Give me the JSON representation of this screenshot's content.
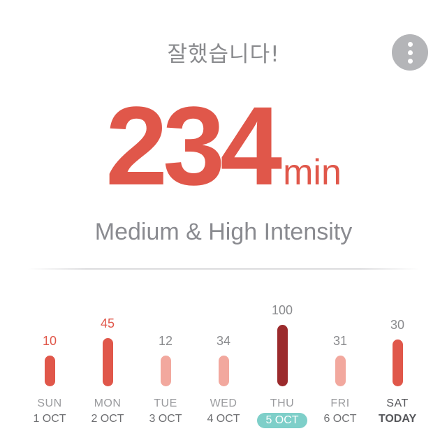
{
  "header": {
    "praise": "잘했습니다!",
    "more_icon": "more-vertical-icon"
  },
  "summary": {
    "value": "234",
    "unit": "min",
    "intensity": "Medium & High Intensity"
  },
  "colors": {
    "accent": "#e0574a",
    "bar_high": "#e0574a",
    "bar_low": "#f2a89e",
    "bar_selected": "#9b2a2c",
    "selected_badge": "#7ecfc9"
  },
  "chart_data": {
    "type": "bar",
    "categories": [
      "SUN 1 OCT",
      "MON 2 OCT",
      "TUE 3 OCT",
      "WED 4 OCT",
      "THU 5 OCT",
      "FRI 6 OCT",
      "SAT TODAY"
    ],
    "values": [
      10,
      45,
      12,
      34,
      100,
      31,
      30
    ],
    "ylim": [
      0,
      100
    ]
  },
  "week": [
    {
      "day": "SUN",
      "date": "1 OCT",
      "value": "10",
      "level": 0.5,
      "style": "high",
      "label_color": "red"
    },
    {
      "day": "MON",
      "date": "2 OCT",
      "value": "45",
      "level": 0.78,
      "style": "high",
      "label_color": "red"
    },
    {
      "day": "TUE",
      "date": "3 OCT",
      "value": "12",
      "level": 0.5,
      "style": "low",
      "label_color": "gray"
    },
    {
      "day": "WED",
      "date": "4 OCT",
      "value": "34",
      "level": 0.5,
      "style": "low",
      "label_color": "gray"
    },
    {
      "day": "THU",
      "date": "5 OCT",
      "value": "100",
      "level": 1.0,
      "style": "selected",
      "label_color": "gray",
      "selected": true
    },
    {
      "day": "FRI",
      "date": "6 OCT",
      "value": "31",
      "level": 0.5,
      "style": "low",
      "label_color": "gray"
    },
    {
      "day": "SAT",
      "date": "TODAY",
      "value": "30",
      "level": 0.76,
      "style": "high",
      "label_color": "gray",
      "today": true
    }
  ]
}
